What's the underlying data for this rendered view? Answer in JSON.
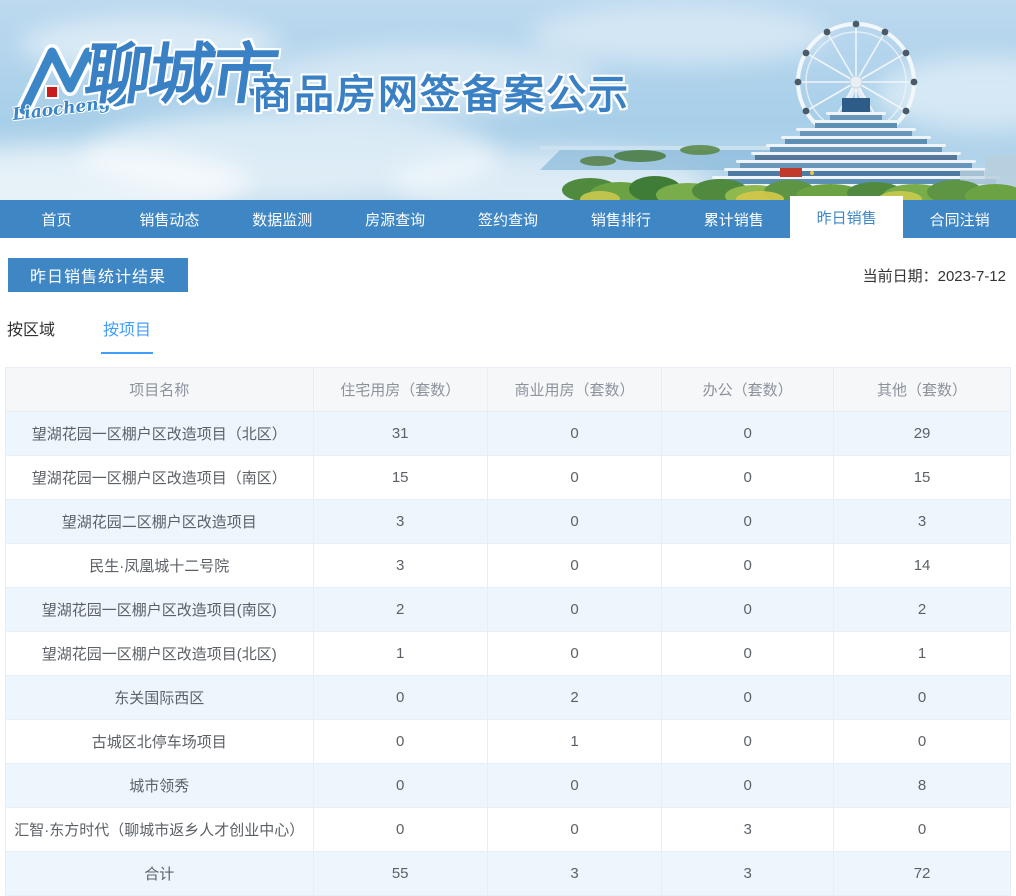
{
  "banner": {
    "logo_script": "Liaocheng",
    "logo_city": "聊城市",
    "title": "商品房网签备案公示"
  },
  "nav": {
    "items": [
      {
        "key": "home",
        "label": "首页",
        "active": false
      },
      {
        "key": "sales-trends",
        "label": "销售动态",
        "active": false
      },
      {
        "key": "data-monitor",
        "label": "数据监测",
        "active": false
      },
      {
        "key": "listing-query",
        "label": "房源查询",
        "active": false
      },
      {
        "key": "signing-query",
        "label": "签约查询",
        "active": false
      },
      {
        "key": "sales-ranking",
        "label": "销售排行",
        "active": false
      },
      {
        "key": "total-sales",
        "label": "累计销售",
        "active": false
      },
      {
        "key": "yesterday-sales",
        "label": "昨日销售",
        "active": true
      },
      {
        "key": "contract-cancel",
        "label": "合同注销",
        "active": false
      }
    ]
  },
  "page": {
    "section_title": "昨日销售统计结果",
    "date_label": "当前日期：",
    "date_value": "2023-7-12"
  },
  "tabs": [
    {
      "key": "by-region",
      "label": "按区域",
      "active": false
    },
    {
      "key": "by-project",
      "label": "按项目",
      "active": true
    }
  ],
  "table": {
    "columns": [
      "项目名称",
      "住宅用房（套数）",
      "商业用房（套数）",
      "办公（套数）",
      "其他（套数）"
    ],
    "rows": [
      {
        "name": "望湖花园一区棚户区改造项目（北区）",
        "values": [
          "31",
          "0",
          "0",
          "29"
        ]
      },
      {
        "name": "望湖花园一区棚户区改造项目（南区）",
        "values": [
          "15",
          "0",
          "0",
          "15"
        ]
      },
      {
        "name": "望湖花园二区棚户区改造项目",
        "values": [
          "3",
          "0",
          "0",
          "3"
        ]
      },
      {
        "name": "民生·凤凰城十二号院",
        "values": [
          "3",
          "0",
          "0",
          "14"
        ]
      },
      {
        "name": "望湖花园一区棚户区改造项目(南区)",
        "values": [
          "2",
          "0",
          "0",
          "2"
        ]
      },
      {
        "name": "望湖花园一区棚户区改造项目(北区)",
        "values": [
          "1",
          "0",
          "0",
          "1"
        ]
      },
      {
        "name": "东关国际西区",
        "values": [
          "0",
          "2",
          "0",
          "0"
        ]
      },
      {
        "name": "古城区北停车场项目",
        "values": [
          "0",
          "1",
          "0",
          "0"
        ]
      },
      {
        "name": "城市领秀",
        "values": [
          "0",
          "0",
          "0",
          "8"
        ]
      },
      {
        "name": "汇智·东方时代（聊城市返乡人才创业中心）",
        "values": [
          "0",
          "0",
          "3",
          "0"
        ]
      },
      {
        "name": "合计",
        "values": [
          "55",
          "3",
          "3",
          "72"
        ]
      }
    ]
  },
  "colors": {
    "nav_blue": "#3e86c4",
    "active_subtab_blue": "#409eff",
    "stripe_row": "#eef6fd",
    "table_header_bg": "#f6f7f9",
    "table_border": "#e9eef4",
    "banner_text_blue": "#3a80c4"
  }
}
